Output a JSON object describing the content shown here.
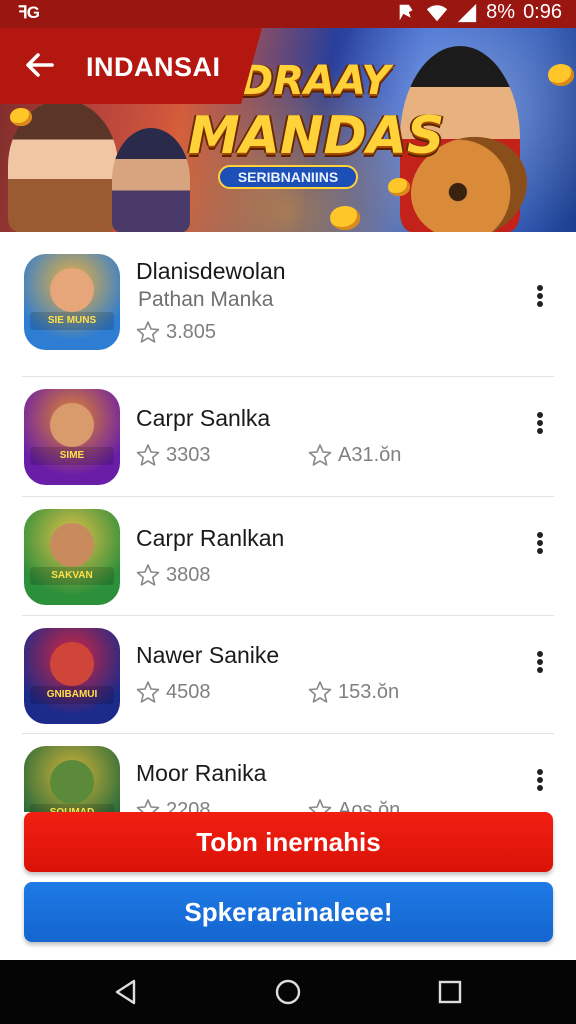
{
  "status_bar": {
    "left_text": "ꟻG",
    "battery_text": "8%",
    "time": "0:96"
  },
  "header": {
    "title": "INDANSAI",
    "back_icon": "arrow-left-icon"
  },
  "banner": {
    "logo_line1": "DRAAY",
    "logo_line2": "MANDAS",
    "logo_subtitle": "SERIBNANIINS"
  },
  "list": {
    "items": [
      {
        "title": "Dlanisdewolan",
        "subtitle": "Pathan Manka",
        "stat1": "3.805",
        "stat2": "",
        "thumb_label": "SIE MUNS",
        "thumb_colors": [
          "#2d7dd2",
          "#f0b23a"
        ]
      },
      {
        "title": "Carpr Sanlka",
        "subtitle": "",
        "stat1": "3303",
        "stat2": "A31.ŏn",
        "thumb_label": "SIME",
        "thumb_colors": [
          "#6a1ea8",
          "#e48a2a"
        ]
      },
      {
        "title": "Carpr Ranlkan",
        "subtitle": "",
        "stat1": "3808",
        "stat2": "",
        "thumb_label": "SAKVAN",
        "thumb_colors": [
          "#2c8f3a",
          "#e8c14a"
        ]
      },
      {
        "title": "Nawer Sanike",
        "subtitle": "",
        "stat1": "4508",
        "stat2": "153.ŏn",
        "thumb_label": "GNIBAMUI",
        "thumb_colors": [
          "#1c2a8a",
          "#d8263a"
        ]
      },
      {
        "title": "Moor Ranika",
        "subtitle": "",
        "stat1": "2208",
        "stat2": "Aos.ŏn",
        "thumb_label": "SOUMAD",
        "thumb_colors": [
          "#2b6b3a",
          "#d4b53a"
        ]
      }
    ]
  },
  "buttons": {
    "primary_label": "Tobn inernahis",
    "secondary_label": "Spkerarainaleee!"
  },
  "colors": {
    "brand_red": "#b3170f",
    "button_red": "#e8170d",
    "button_blue": "#1a6fdb"
  }
}
